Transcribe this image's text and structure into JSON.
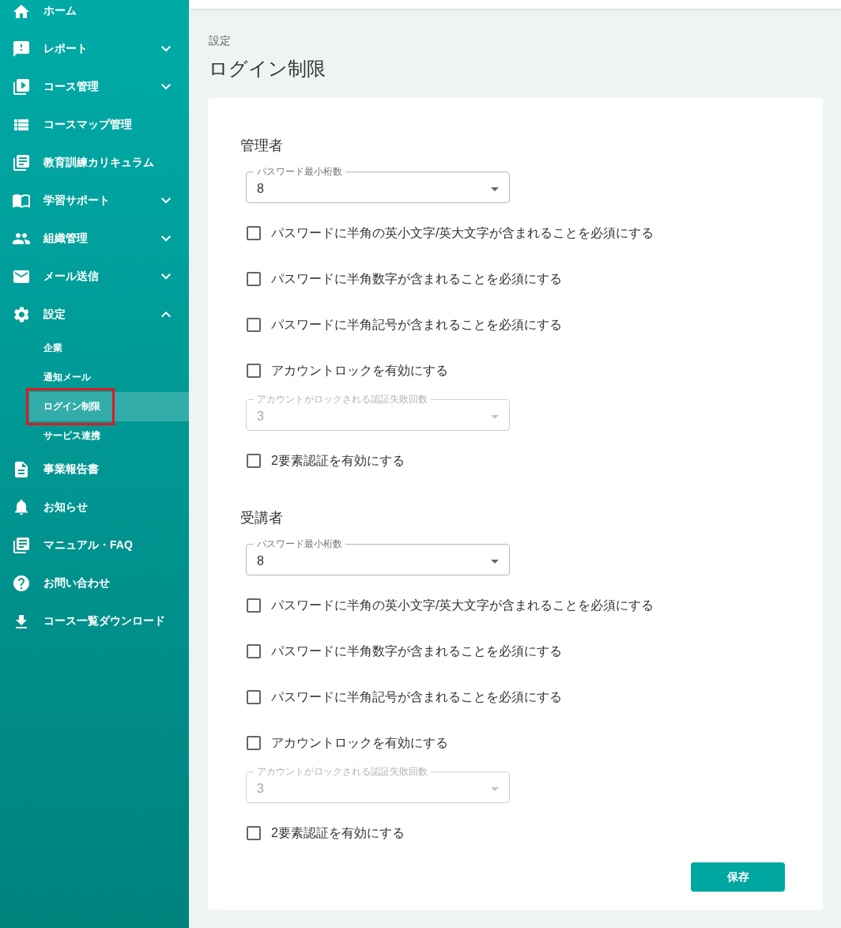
{
  "sidebar": {
    "items": [
      {
        "kind": "link",
        "label": "ホーム"
      },
      {
        "kind": "group",
        "label": "レポート",
        "expanded": false
      },
      {
        "kind": "group",
        "label": "コース管理",
        "expanded": false
      },
      {
        "kind": "link",
        "label": "コースマップ管理"
      },
      {
        "kind": "link",
        "label": "教育訓練カリキュラム"
      },
      {
        "kind": "group",
        "label": "学習サポート",
        "expanded": false
      },
      {
        "kind": "group",
        "label": "組織管理",
        "expanded": false
      },
      {
        "kind": "group",
        "label": "メール送信",
        "expanded": false
      },
      {
        "kind": "group",
        "label": "設定",
        "expanded": true,
        "children": [
          {
            "label": "企業",
            "selected": false,
            "annotated": false
          },
          {
            "label": "通知メール",
            "selected": false,
            "annotated": false
          },
          {
            "label": "ログイン制限",
            "selected": true,
            "annotated": true
          },
          {
            "label": "サービス連携",
            "selected": false,
            "annotated": false
          }
        ]
      },
      {
        "kind": "link",
        "label": "事業報告書"
      },
      {
        "kind": "link",
        "label": "お知らせ"
      },
      {
        "kind": "link",
        "label": "マニュアル・FAQ"
      },
      {
        "kind": "link",
        "label": "お問い合わせ"
      },
      {
        "kind": "link",
        "label": "コース一覧ダウンロード"
      }
    ]
  },
  "page": {
    "breadcrumb": "設定",
    "title": "ログイン制限"
  },
  "sections": [
    {
      "heading": "管理者",
      "fields": [
        {
          "kind": "select",
          "label": "パスワード最小桁数",
          "value": "8",
          "disabled": false
        },
        {
          "kind": "checkbox",
          "label": "パスワードに半角の英小文字/英大文字が含まれることを必須にする",
          "checked": false
        },
        {
          "kind": "checkbox",
          "label": "パスワードに半角数字が含まれることを必須にする",
          "checked": false
        },
        {
          "kind": "checkbox",
          "label": "パスワードに半角記号が含まれることを必須にする",
          "checked": false
        },
        {
          "kind": "checkbox",
          "label": "アカウントロックを有効にする",
          "checked": false
        },
        {
          "kind": "select",
          "label": "アカウントがロックされる認証失敗回数",
          "value": "3",
          "disabled": true
        },
        {
          "kind": "checkbox",
          "label": "2要素認証を有効にする",
          "checked": false
        }
      ]
    },
    {
      "heading": "受講者",
      "fields": [
        {
          "kind": "select",
          "label": "パスワード最小桁数",
          "value": "8",
          "disabled": false
        },
        {
          "kind": "checkbox",
          "label": "パスワードに半角の英小文字/英大文字が含まれることを必須にする",
          "checked": false
        },
        {
          "kind": "checkbox",
          "label": "パスワードに半角数字が含まれることを必須にする",
          "checked": false
        },
        {
          "kind": "checkbox",
          "label": "パスワードに半角記号が含まれることを必須にする",
          "checked": false
        },
        {
          "kind": "checkbox",
          "label": "アカウントロックを有効にする",
          "checked": false
        },
        {
          "kind": "select",
          "label": "アカウントがロックされる認証失敗回数",
          "value": "3",
          "disabled": true
        },
        {
          "kind": "checkbox",
          "label": "2要素認証を有効にする",
          "checked": false
        }
      ]
    }
  ],
  "save_button": {
    "label": "保存"
  }
}
